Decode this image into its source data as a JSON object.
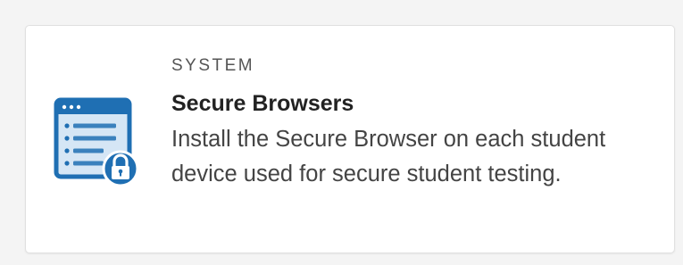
{
  "card": {
    "category": "SYSTEM",
    "title": "Secure Browsers",
    "description": "Install the Secure Browser on each student device used for secure student testing.",
    "icon": "secure-browser-lock-icon"
  },
  "colors": {
    "icon_blue": "#1f6fb3",
    "icon_light": "#d5e6f5",
    "card_border": "#e0e0e0",
    "page_background": "#f4f4f4"
  }
}
